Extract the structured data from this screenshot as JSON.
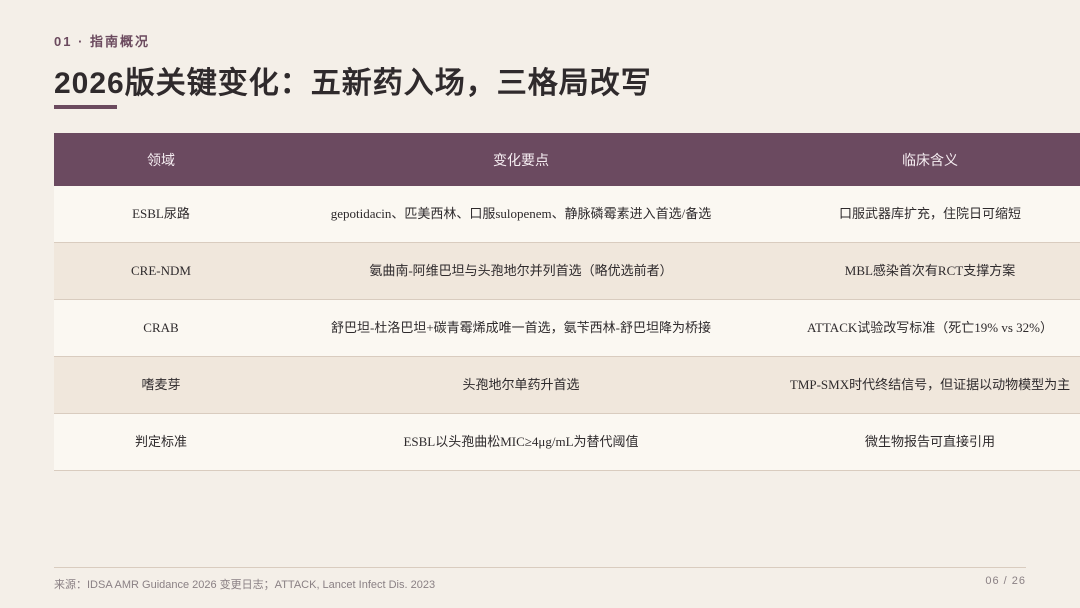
{
  "header": {
    "section_label": "01 · 指南概况",
    "title": "2026版关键变化：五新药入场，三格局改写"
  },
  "table": {
    "columns": [
      "领域",
      "变化要点",
      "临床含义"
    ],
    "rows": [
      {
        "domain": "ESBL尿路",
        "change": "gepotidacin、匹美西林、口服sulopenem、静脉磷霉素进入首选/备选",
        "clinical": "口服武器库扩充，住院日可缩短"
      },
      {
        "domain": "CRE-NDM",
        "change": "氨曲南-阿维巴坦与头孢地尔并列首选（略优选前者）",
        "clinical": "MBL感染首次有RCT支撑方案"
      },
      {
        "domain": "CRAB",
        "change": "舒巴坦-杜洛巴坦+碳青霉烯成唯一首选，氨苄西林-舒巴坦降为桥接",
        "clinical": "ATTACK试验改写标准（死亡19% vs 32%）"
      },
      {
        "domain": "嗜麦芽",
        "change": "头孢地尔单药升首选",
        "clinical": "TMP-SMX时代终结信号，但证据以动物模型为主"
      },
      {
        "domain": "判定标准",
        "change": "ESBL以头孢曲松MIC≥4μg/mL为替代阈值",
        "clinical": "微生物报告可直接引用"
      }
    ]
  },
  "footer": {
    "source": "来源：IDSA AMR Guidance 2026 变更日志；ATTACK, Lancet Infect Dis. 2023",
    "page": "06 / 26"
  },
  "colors": {
    "accent": "#6b4a5e",
    "header_bg": "#6b4a60",
    "background": "#f4efe8",
    "row_light": "#fbf8f2",
    "row_dark": "#f0e7dc"
  }
}
